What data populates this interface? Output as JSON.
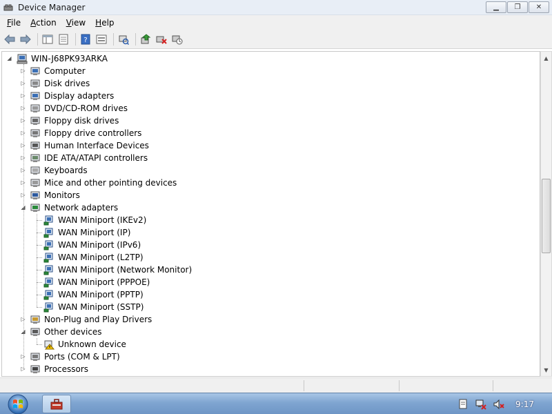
{
  "window": {
    "title": "Device Manager",
    "buttons": [
      "minimize",
      "maximize",
      "close"
    ]
  },
  "menubar": [
    "File",
    "Action",
    "View",
    "Help"
  ],
  "toolbar": [
    "back-arrow-icon",
    "forward-arrow-icon",
    "show-hide-tree-icon",
    "properties-icon",
    "help-icon",
    "view-icon",
    "scan-hardware-icon",
    "update-driver-icon",
    "uninstall-icon",
    "disable-icon"
  ],
  "tree": {
    "root": "WIN-J68PK93ARKA",
    "categories": [
      {
        "label": "Computer",
        "icon": "computer-icon",
        "expanded": false
      },
      {
        "label": "Disk drives",
        "icon": "disk-drive-icon",
        "expanded": false
      },
      {
        "label": "Display adapters",
        "icon": "display-adapter-icon",
        "expanded": false
      },
      {
        "label": "DVD/CD-ROM drives",
        "icon": "dvd-icon",
        "expanded": false
      },
      {
        "label": "Floppy disk drives",
        "icon": "floppy-icon",
        "expanded": false
      },
      {
        "label": "Floppy drive controllers",
        "icon": "floppy-controller-icon",
        "expanded": false
      },
      {
        "label": "Human Interface Devices",
        "icon": "hid-icon",
        "expanded": false
      },
      {
        "label": "IDE ATA/ATAPI controllers",
        "icon": "ide-controller-icon",
        "expanded": false
      },
      {
        "label": "Keyboards",
        "icon": "keyboard-icon",
        "expanded": false
      },
      {
        "label": "Mice and other pointing devices",
        "icon": "mouse-icon",
        "expanded": false
      },
      {
        "label": "Monitors",
        "icon": "monitor-icon",
        "expanded": false
      },
      {
        "label": "Network adapters",
        "icon": "network-adapter-icon",
        "expanded": true,
        "children": [
          "WAN Miniport (IKEv2)",
          "WAN Miniport (IP)",
          "WAN Miniport (IPv6)",
          "WAN Miniport (L2TP)",
          "WAN Miniport (Network Monitor)",
          "WAN Miniport (PPPOE)",
          "WAN Miniport (PPTP)",
          "WAN Miniport (SSTP)"
        ]
      },
      {
        "label": "Non-Plug and Play Drivers",
        "icon": "driver-icon",
        "expanded": false
      },
      {
        "label": "Other devices",
        "icon": "other-devices-icon",
        "expanded": true,
        "children": [
          "Unknown device"
        ]
      },
      {
        "label": "Ports (COM & LPT)",
        "icon": "port-icon",
        "expanded": false
      },
      {
        "label": "Processors",
        "icon": "processor-icon",
        "expanded": false
      }
    ]
  },
  "taskbar": {
    "clock": "9:17",
    "tray_icons": [
      "action-center-icon",
      "network-error-icon",
      "volume-muted-icon"
    ]
  },
  "colors": {
    "titlebar": "#e8eef6",
    "chrome": "#f0f0f0",
    "taskbar": "#7fa5d1"
  }
}
